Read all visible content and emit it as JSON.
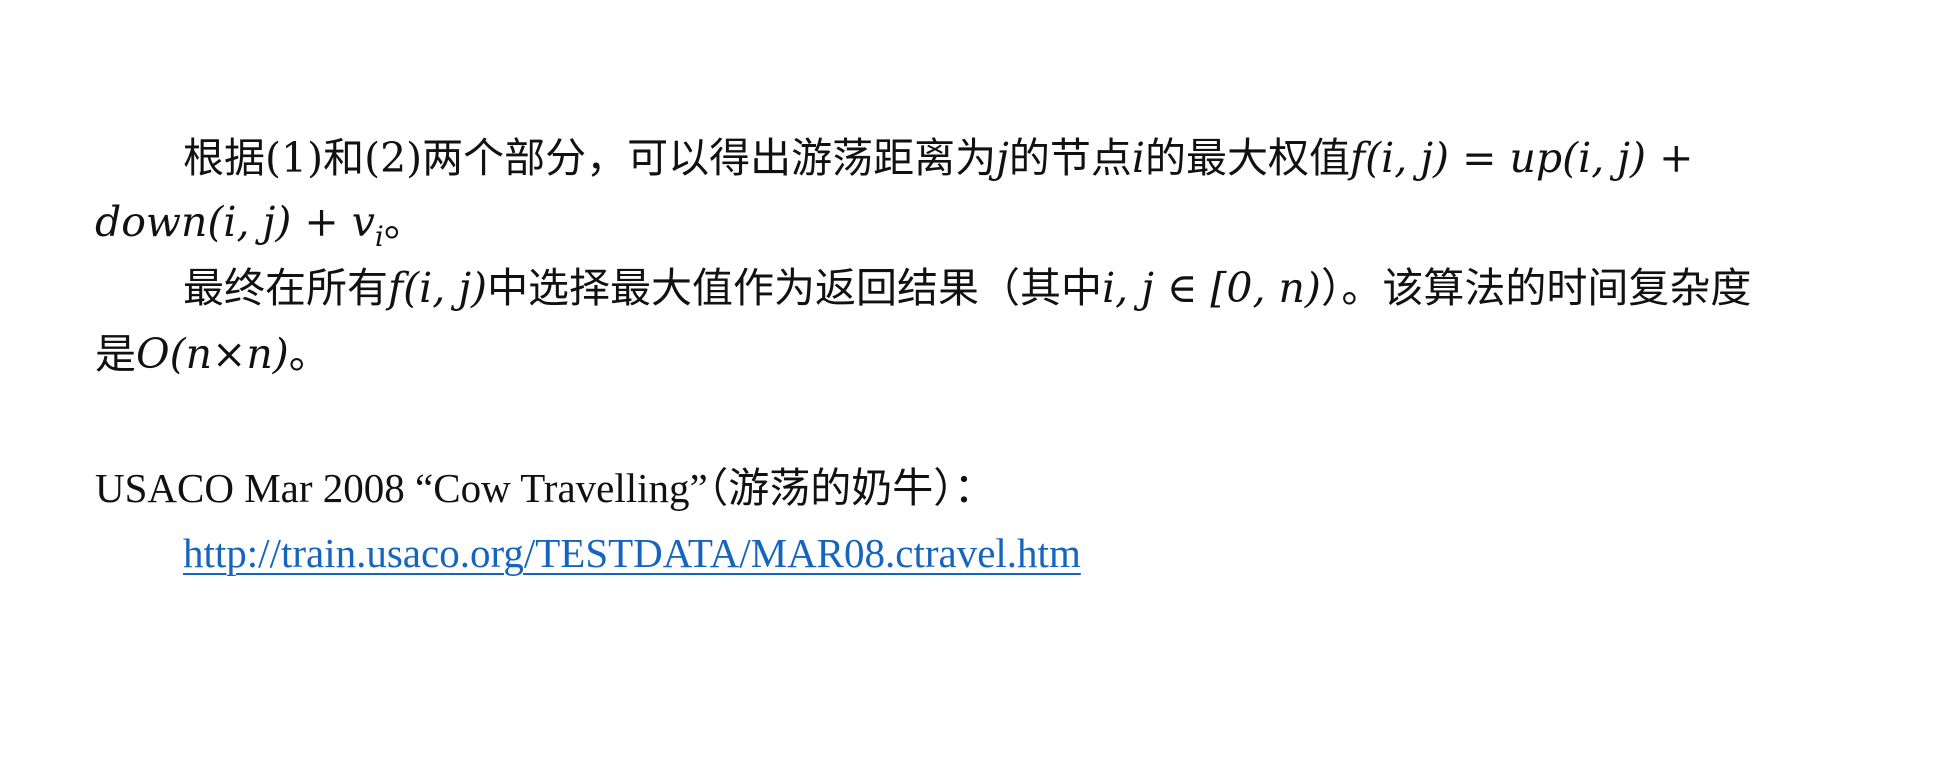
{
  "paragraph1": {
    "a": "根据(1)和(2)两个部分，可以得出游荡距离为",
    "j": "j",
    "b": "的节点",
    "i": "i",
    "c": "的最大权值",
    "eq_lhs": "f(i, j)",
    "eq_eq": " = ",
    "eq_rhs1": "up(i, j)",
    "eq_plus": " +",
    "line2_a": "down(i, j)",
    "line2_plus": " + ",
    "line2_v": "v",
    "line2_sub": "i",
    "line2_end": "。"
  },
  "paragraph2": {
    "a": "最终在所有",
    "f": "f(i, j)",
    "b": "中选择最大值作为返回结果（其中",
    "range_vars": "i, j",
    "range_in": " ∈ ",
    "range": "[0, n)",
    "c": "）。该算法的时间复杂度",
    "line2_a": "是",
    "complexity": "O(n×n)",
    "line2_end": "。"
  },
  "reference": {
    "title": "USACO Mar 2008 “Cow Travelling”（游荡的奶牛）：",
    "url": "http://train.usaco.org/TESTDATA/MAR08.ctravel.htm"
  }
}
